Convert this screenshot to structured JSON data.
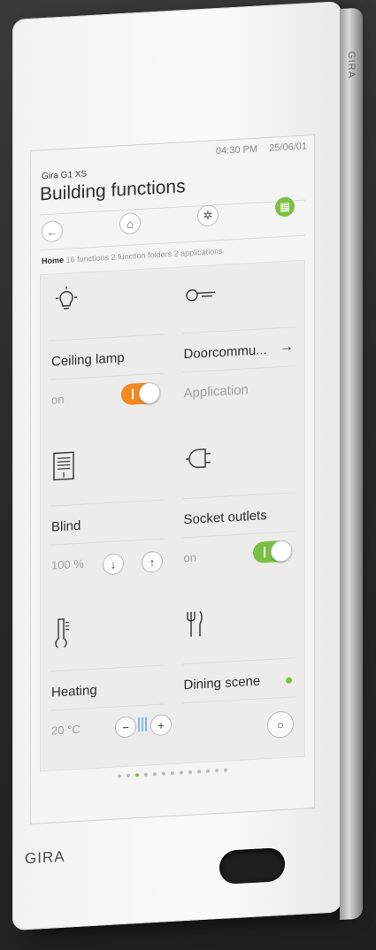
{
  "status": {
    "time": "04:30 PM",
    "date": "25/06/01"
  },
  "header": {
    "device_label": "Gira G1 XS",
    "title": "Building functions"
  },
  "nav": {
    "back_icon": "arrow-left-icon",
    "home_icon": "home-icon",
    "settings_icon": "gear-icon",
    "grid_icon": "grid-icon",
    "grid_color": "#7bc043"
  },
  "breadcrumb": {
    "home": "Home",
    "summary": "16 functions 2 function folders 2 applications"
  },
  "tiles": [
    {
      "name": "Ceiling lamp",
      "state": "on",
      "icon": "lamp-icon",
      "toggle_on": true,
      "toggle_color": "#f28a1f"
    },
    {
      "name": "Doorcommu...",
      "sub": "Application",
      "icon": "key-icon"
    },
    {
      "name": "Blind",
      "value": "100 %",
      "icon": "blind-icon"
    },
    {
      "name": "Socket outlets",
      "state": "on",
      "icon": "socket-icon",
      "toggle_on": true,
      "toggle_color": "#7bc043"
    },
    {
      "name": "Heating",
      "value": "20 °C",
      "icon": "thermometer-icon"
    },
    {
      "name": "Dining scene",
      "icon": "cutlery-icon",
      "indicator_color": "#7bc043"
    }
  ],
  "pager": {
    "count": 13,
    "active_index": 2
  },
  "brand": "GIRA",
  "edge_label": "GIRA"
}
